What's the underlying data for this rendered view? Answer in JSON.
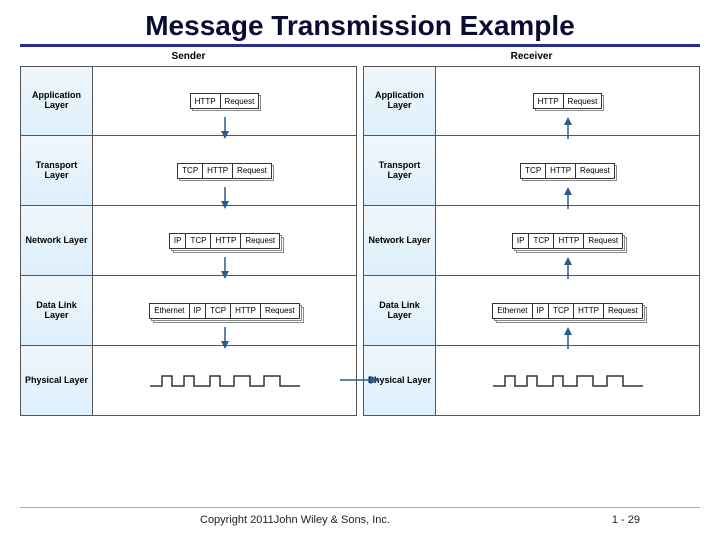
{
  "title": "Message Transmission Example",
  "columns": {
    "sender": {
      "header": "Sender"
    },
    "receiver": {
      "header": "Receiver"
    }
  },
  "layers": [
    {
      "name": "Application Layer",
      "segments": [
        "HTTP",
        "Request"
      ],
      "stack_depth": 2
    },
    {
      "name": "Transport Layer",
      "segments": [
        "TCP",
        "HTTP",
        "Request"
      ],
      "stack_depth": 2
    },
    {
      "name": "Network Layer",
      "segments": [
        "IP",
        "TCP",
        "HTTP",
        "Request"
      ],
      "stack_depth": 3
    },
    {
      "name": "Data Link Layer",
      "segments": [
        "Ethernet",
        "IP",
        "TCP",
        "HTTP",
        "Request"
      ],
      "stack_depth": 3
    },
    {
      "name": "Physical Layer",
      "segments": [],
      "stack_depth": 0
    }
  ],
  "footer": {
    "copyright": "Copyright 2011John Wiley & Sons, Inc.",
    "page": "1 - 29"
  }
}
